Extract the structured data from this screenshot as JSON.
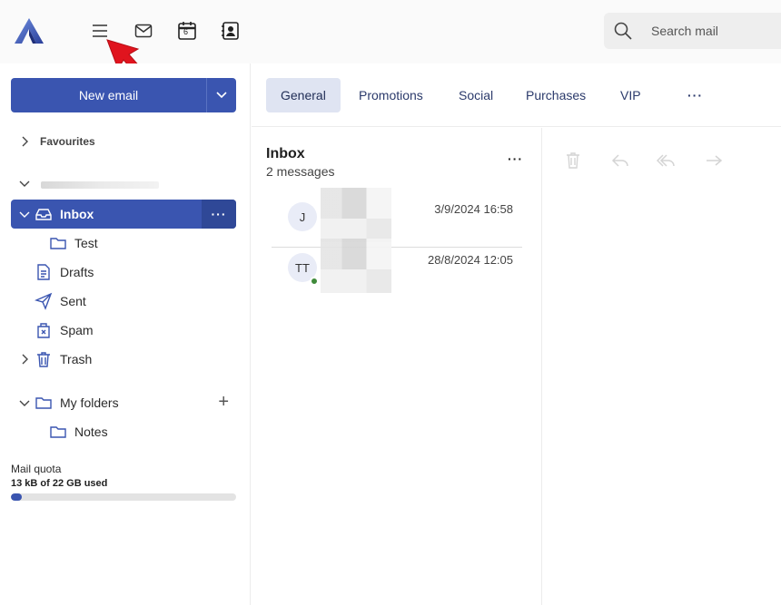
{
  "header": {
    "search_placeholder": "Search mail",
    "calendar_day": "6"
  },
  "sidebar": {
    "new_email_label": "New email",
    "favourites_label": "Favourites",
    "folders": [
      {
        "label": "Inbox"
      },
      {
        "label": "Test"
      },
      {
        "label": "Drafts"
      },
      {
        "label": "Sent"
      },
      {
        "label": "Spam"
      },
      {
        "label": "Trash"
      },
      {
        "label": "My folders"
      },
      {
        "label": "Notes"
      }
    ],
    "more_label": "···"
  },
  "quota": {
    "title": "Mail quota",
    "usage": "13 kB of 22 GB used",
    "fraction": 0.05
  },
  "tabs": [
    {
      "label": "General"
    },
    {
      "label": "Promotions"
    },
    {
      "label": "Social"
    },
    {
      "label": "Purchases"
    },
    {
      "label": "VIP"
    },
    {
      "label": "···"
    }
  ],
  "message_list": {
    "title": "Inbox",
    "count": "2 messages",
    "more_label": "···",
    "messages": [
      {
        "initials": "J",
        "date": "3/9/2024 16:58"
      },
      {
        "initials": "TT",
        "date": "28/8/2024 12:05"
      }
    ]
  },
  "colors": {
    "accent": "#3a55b0",
    "arrow": "#e0141e",
    "online": "#3f8a3a"
  }
}
